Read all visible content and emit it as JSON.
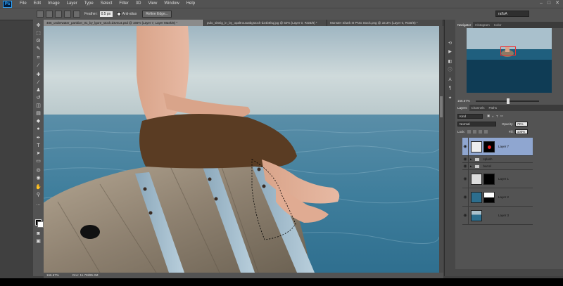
{
  "app": {
    "logo": "Ps",
    "menu": [
      "File",
      "Edit",
      "Image",
      "Layer",
      "Type",
      "Select",
      "Filter",
      "3D",
      "View",
      "Window",
      "Help"
    ],
    "window_controls": [
      "–",
      "□",
      "✕"
    ]
  },
  "options": {
    "feather_label": "Feather:",
    "feather_value": "0.5 px",
    "antialias_label": "Anti-alias",
    "refine_label": "Refine Edge...",
    "workspace_value": "ralfsA"
  },
  "tabs": [
    "486_underwater_partition_01_by_lgore_stock.d4v4u4.psd @ 166% (Layer 7, Layer Mask/8) *",
    "pulo_sittnig_in_by_opaltrousatbgstock-d24b6kq.jpg @ 50% (Layer 0, RGB/8) *",
    "Monster Shark III PNG Stock.png @ 33.3% (Layer 0, RGB/8) *"
  ],
  "status": {
    "zoom": "166.67%",
    "doc": "Doc: 11.7M/85.3M"
  },
  "panels": {
    "nav_tabs": [
      "Navigator",
      "Histogram",
      "Color"
    ],
    "nav_zoom": "166.67%",
    "layer_tabs": [
      "Layers",
      "Channels",
      "Paths"
    ],
    "kind_label": "Kind",
    "blend_mode": "Normal",
    "opacity_label": "Opacity:",
    "opacity_value": "79%",
    "lock_label": "Lock:",
    "fill_label": "Fill:",
    "fill_value": "100%",
    "layers": [
      {
        "name": "Layer 7"
      },
      {
        "name": "splash"
      },
      {
        "name": "barrel"
      },
      {
        "name": "Layer 1"
      },
      {
        "name": "Layer 2"
      },
      {
        "name": "Layer 3"
      }
    ]
  },
  "colors": {
    "accent_selected": "#8fa6d0",
    "ui_gray": "#535353"
  }
}
